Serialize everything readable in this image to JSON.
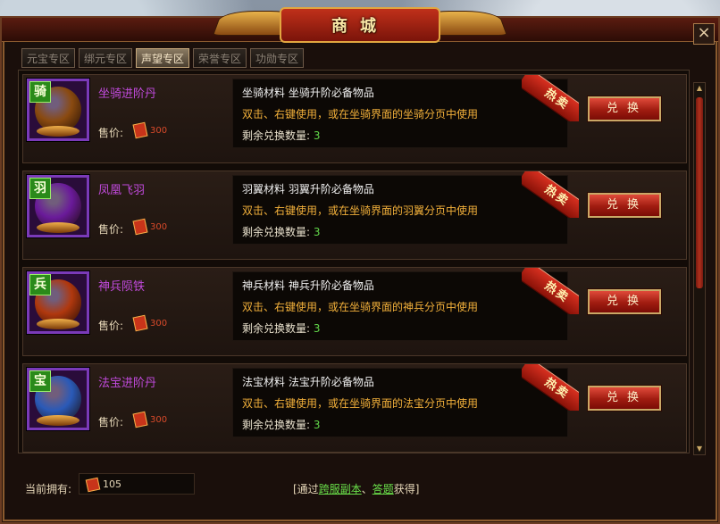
{
  "window": {
    "title": "商城",
    "close_label": "×"
  },
  "tabs": [
    {
      "label": "元宝专区",
      "active": false
    },
    {
      "label": "绑元专区",
      "active": false
    },
    {
      "label": "声望专区",
      "active": true
    },
    {
      "label": "荣誉专区",
      "active": false
    },
    {
      "label": "功勋专区",
      "active": false
    }
  ],
  "items": [
    {
      "name": "坐骑进阶丹",
      "glyph": "骑",
      "price_label": "售价:",
      "price": "300",
      "desc_line1": "坐骑材料 坐骑升阶必备物品",
      "desc_line2": "双击、右键使用，或在坐骑界面的坐骑分页中使用",
      "remaining_label": "剩余兑换数量:",
      "remaining": "3",
      "hot_label": "热卖",
      "button_label": "兑换",
      "orb_color": "#8a4a10",
      "icon": "mount-icon"
    },
    {
      "name": "凤凰飞羽",
      "glyph": "羽",
      "price_label": "售价:",
      "price": "300",
      "desc_line1": "羽翼材料 羽翼升阶必备物品",
      "desc_line2": "双击、右键使用，或在坐骑界面的羽翼分页中使用",
      "remaining_label": "剩余兑换数量:",
      "remaining": "3",
      "hot_label": "热卖",
      "button_label": "兑换",
      "orb_color": "#6a1a9a",
      "icon": "phoenix-feather-icon"
    },
    {
      "name": "神兵陨铁",
      "glyph": "兵",
      "price_label": "售价:",
      "price": "300",
      "desc_line1": "神兵材料 神兵升阶必备物品",
      "desc_line2": "双击、右键使用，或在坐骑界面的神兵分页中使用",
      "remaining_label": "剩余兑换数量:",
      "remaining": "3",
      "hot_label": "热卖",
      "button_label": "兑换",
      "orb_color": "#b0380e",
      "icon": "sword-icon"
    },
    {
      "name": "法宝进阶丹",
      "glyph": "宝",
      "price_label": "售价:",
      "price": "300",
      "desc_line1": "法宝材料 法宝升阶必备物品",
      "desc_line2": "双击、右键使用，或在坐骑界面的法宝分页中使用",
      "remaining_label": "剩余兑换数量:",
      "remaining": "3",
      "hot_label": "热卖",
      "button_label": "兑换",
      "orb_color": "#2a5ab8",
      "icon": "gourd-icon"
    }
  ],
  "footer": {
    "owned_label": "当前拥有:",
    "owned_value": "105",
    "tip_prefix": "[通过",
    "tip_link1": "跨服副本",
    "tip_sep": "、",
    "tip_link2": "答题",
    "tip_suffix": "获得]"
  },
  "colors": {
    "accent": "#c9a866",
    "name": "#c04adc",
    "highlight": "#62d84a",
    "desc_orange": "#f2b03a"
  }
}
